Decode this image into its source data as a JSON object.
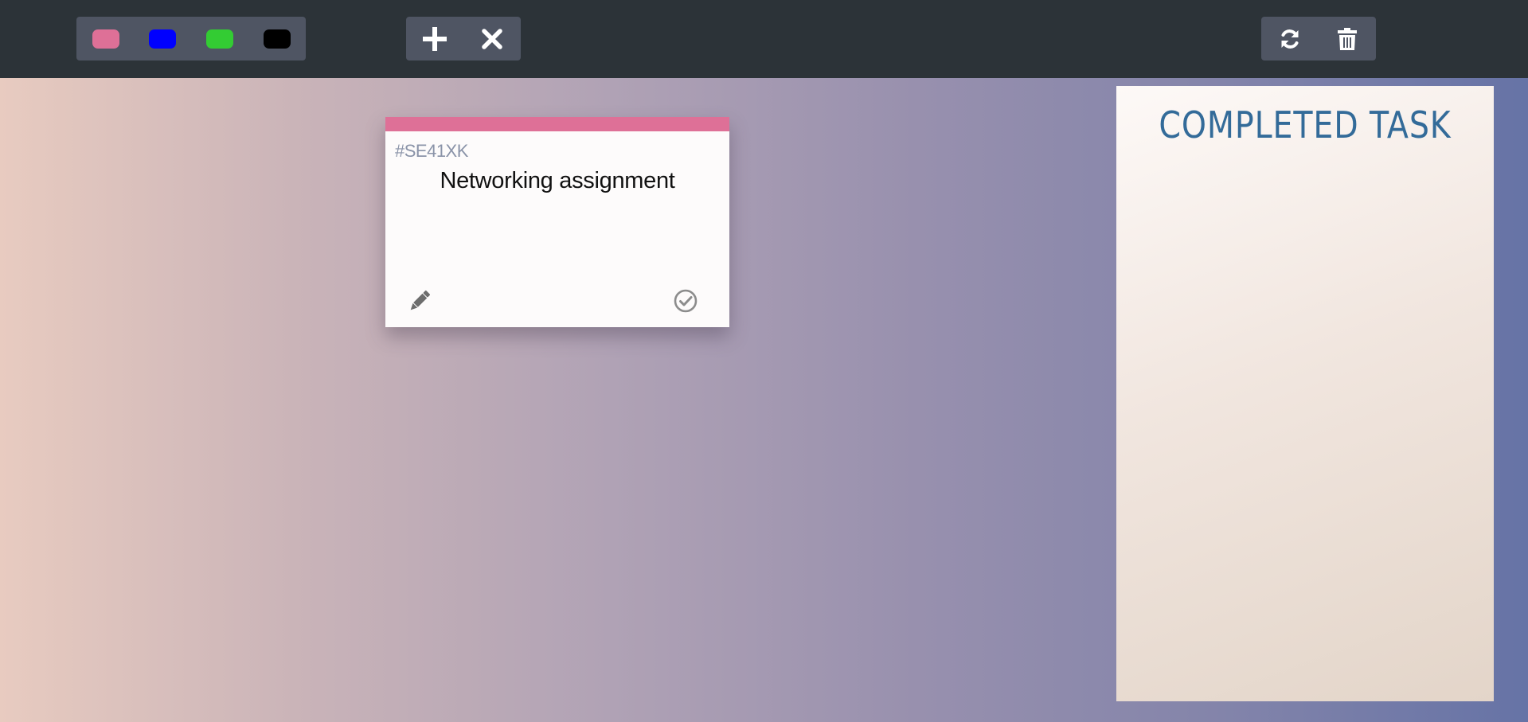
{
  "toolbar": {
    "color_swatches": [
      {
        "name": "pink",
        "color": "#de7097"
      },
      {
        "name": "blue",
        "color": "#0000ff"
      },
      {
        "name": "green",
        "color": "#33cc33"
      },
      {
        "name": "black",
        "color": "#000000"
      }
    ],
    "actions": [
      {
        "icon": "plus-icon"
      },
      {
        "icon": "close-icon"
      }
    ],
    "tools": [
      {
        "icon": "refresh-icon"
      },
      {
        "icon": "trash-icon"
      }
    ]
  },
  "note": {
    "id": "#SE41XK",
    "text": "Networking assignment",
    "color": "#de7097",
    "edit_icon": "pencil-icon",
    "done_icon": "check-circle-icon"
  },
  "completed_panel": {
    "title": "COMPLETED TASK"
  }
}
